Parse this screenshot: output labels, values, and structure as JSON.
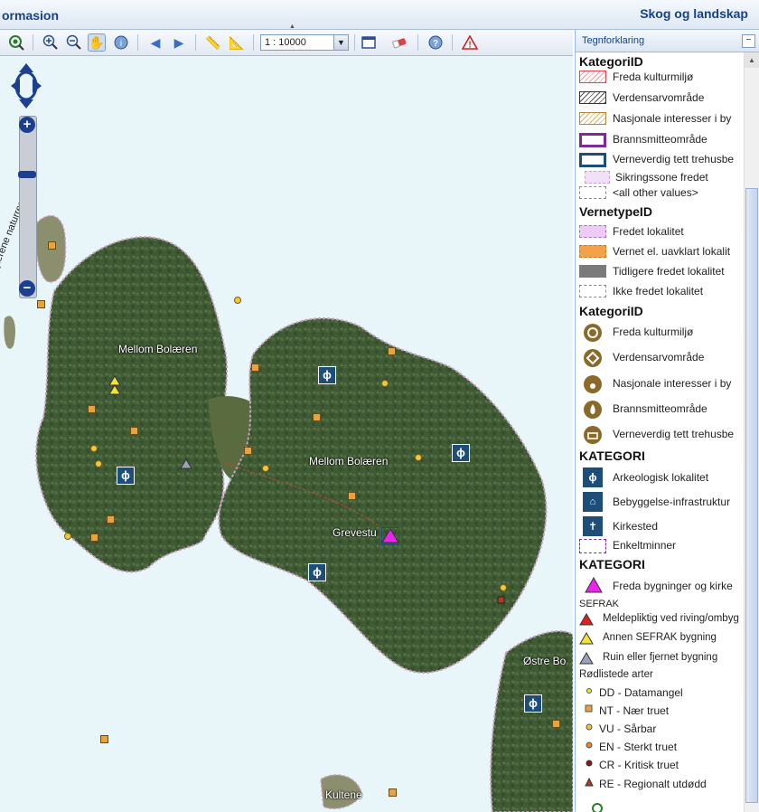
{
  "header": {
    "title_left": "ormasion",
    "title_right": "Skog og landskap"
  },
  "toolbar": {
    "scale_value": "1 : 10000"
  },
  "map": {
    "labels": [
      {
        "id": "mellom1",
        "text": "Mellom Bolæren"
      },
      {
        "id": "mellom2",
        "text": "Mellom Bolæren"
      },
      {
        "id": "grevestu",
        "text": "Grevestu"
      },
      {
        "id": "ostre",
        "text": "Østre Bo"
      },
      {
        "id": "kultene",
        "text": "Kultene"
      },
      {
        "id": "reservat",
        "text": "Jensskjærene naturreservat"
      }
    ]
  },
  "legend": {
    "panel_title": "Tegnforklaring",
    "g1": {
      "title": "KategoriID",
      "items": [
        "Freda kulturmiljø",
        "Verdensarvområde",
        "Nasjonale interesser i by",
        "Brannsmitteområde",
        "Verneverdig tett trehusbe",
        "Sikringssone fredet",
        "<all other values>"
      ]
    },
    "g2": {
      "title": "VernetypeID",
      "items": [
        "Fredet lokalitet",
        "Vernet el. uavklart lokalit",
        "Tidligere fredet lokalitet",
        "Ikke fredet lokalitet"
      ]
    },
    "g3": {
      "title": "KategoriID",
      "items": [
        "Freda kulturmiljø",
        "Verdensarvområde",
        "Nasjonale interesser i by",
        "Brannsmitteområde",
        "Verneverdig tett trehusbe"
      ]
    },
    "g4": {
      "title": "KATEGORI",
      "items": [
        "Arkeologisk lokalitet",
        "Bebyggelse-infrastruktur",
        "Kirkested",
        "Enkeltminner"
      ]
    },
    "g5": {
      "title": "KATEGORI",
      "items": [
        "Freda bygninger og kirke"
      ]
    },
    "g6": {
      "title": "SEFRAK",
      "items": [
        "Meldepliktig ved riving/ombyg",
        "Annen SEFRAK bygning",
        "Ruin eller fjernet bygning"
      ]
    },
    "g7": {
      "title": "Rødlistede arter",
      "items": [
        "DD - Datamangel",
        "NT - Nær truet",
        "VU - Sårbar",
        "EN - Sterkt truet",
        "CR - Kritisk truet",
        "RE - Regionalt utdødd"
      ]
    }
  }
}
